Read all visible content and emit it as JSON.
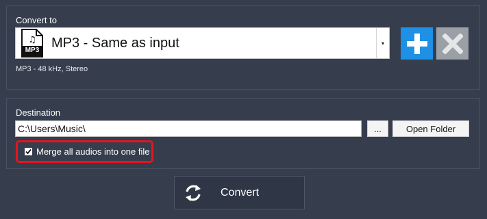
{
  "convert_section": {
    "label": "Convert to",
    "format": {
      "icon_text": "MP3",
      "name": "MP3 - Same as input",
      "details": "MP3  -  48 kHz,  Stereo"
    },
    "add_icon": "plus-icon",
    "remove_icon": "x-icon"
  },
  "destination_section": {
    "label": "Destination",
    "path": "C:\\Users\\Music\\",
    "browse_label": "...",
    "open_folder_label": "Open Folder",
    "merge_label": "Merge all audios into one file",
    "merge_checked": true
  },
  "convert_button": {
    "label": "Convert",
    "icon": "refresh-icon"
  },
  "colors": {
    "background": "#363d4d",
    "add_button": "#1e90e6",
    "remove_button": "#9aa0a6",
    "highlight": "#e8141e"
  }
}
